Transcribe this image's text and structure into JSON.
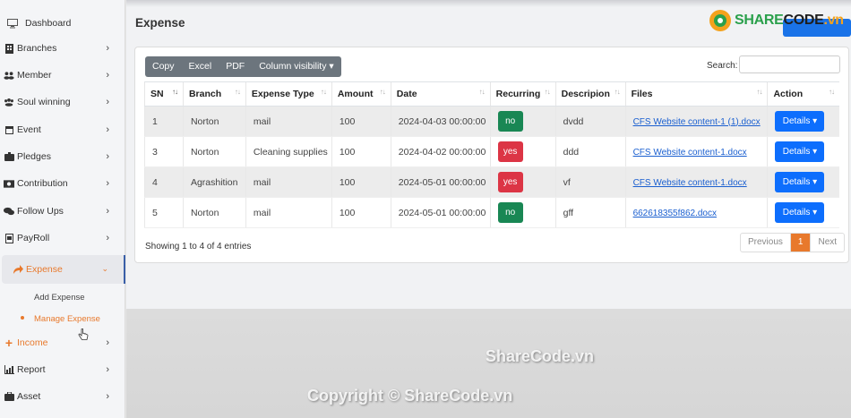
{
  "sidebar": {
    "items": [
      {
        "label": "Dashboard",
        "icon": "monitor-icon"
      },
      {
        "label": "Branches",
        "icon": "building-icon"
      },
      {
        "label": "Member",
        "icon": "users-icon"
      },
      {
        "label": "Soul winning",
        "icon": "group-icon"
      },
      {
        "label": "Event",
        "icon": "calendar-icon"
      },
      {
        "label": "Pledges",
        "icon": "handshake-icon"
      },
      {
        "label": "Contribution",
        "icon": "money-icon"
      },
      {
        "label": "Follow Ups",
        "icon": "chat-icon"
      },
      {
        "label": "PayRoll",
        "icon": "receipt-icon"
      },
      {
        "label": "Expense",
        "icon": "share-icon"
      },
      {
        "label": "Income",
        "icon": "plus-icon"
      },
      {
        "label": "Report",
        "icon": "chart-icon"
      },
      {
        "label": "Asset",
        "icon": "briefcase-icon"
      }
    ],
    "sub_items": [
      {
        "label": "Add Expense"
      },
      {
        "label": "Manage Expense"
      }
    ]
  },
  "page": {
    "title": "Expense"
  },
  "logo": {
    "part1": "SHARE",
    "part2": "CODE",
    "part3": ".vn"
  },
  "toolbar": {
    "copy": "Copy",
    "excel": "Excel",
    "pdf": "PDF",
    "column_visibility": "Column visibility ▾"
  },
  "search": {
    "label": "Search:",
    "value": ""
  },
  "table": {
    "headers": [
      "SN",
      "Branch",
      "Expense Type",
      "Amount",
      "Date",
      "Recurring",
      "Descripion",
      "Files",
      "Action"
    ],
    "rows": [
      {
        "sn": "1",
        "branch": "Norton",
        "type": "mail",
        "amount": "100",
        "date": "2024-04-03 00:00:00",
        "recurring": "no",
        "desc": "dvdd",
        "file": "CFS Website content-1 (1).docx",
        "action": "Details ▾"
      },
      {
        "sn": "3",
        "branch": "Norton",
        "type": "Cleaning supplies",
        "amount": "100",
        "date": "2024-04-02 00:00:00",
        "recurring": "yes",
        "desc": "ddd",
        "file": "CFS Website content-1.docx",
        "action": "Details ▾"
      },
      {
        "sn": "4",
        "branch": "Agrashition",
        "type": "mail",
        "amount": "100",
        "date": "2024-05-01 00:00:00",
        "recurring": "yes",
        "desc": "vf",
        "file": "CFS Website content-1.docx",
        "action": "Details ▾"
      },
      {
        "sn": "5",
        "branch": "Norton",
        "type": "mail",
        "amount": "100",
        "date": "2024-05-01 00:00:00",
        "recurring": "no",
        "desc": "gff",
        "file": "662618355f862.docx",
        "action": "Details ▾"
      }
    ]
  },
  "footer": {
    "info": "Showing 1 to 4 of 4 entries",
    "prev": "Previous",
    "page": "1",
    "next": "Next"
  },
  "watermarks": {
    "top": "ShareCode.vn",
    "bottom": "Copyright © ShareCode.vn"
  },
  "colors": {
    "accent": "#e8792c",
    "primary": "#0d6efd",
    "success": "#198754",
    "danger": "#dc3545"
  }
}
